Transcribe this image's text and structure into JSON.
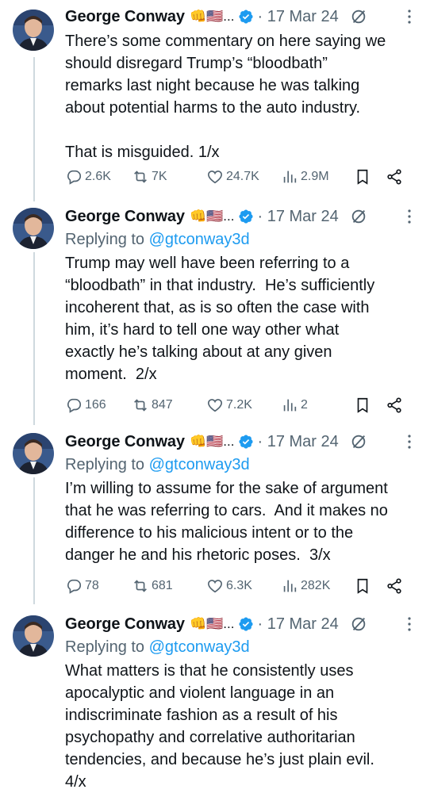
{
  "tweets": [
    {
      "author": "George Conway",
      "badges": "👊🇺🇸...",
      "time": "· 17 Mar 24",
      "replying_prefix": "",
      "replying_handle": "",
      "text": "There’s some commentary on here saying we\nshould disregard Trump’s “bloodbath”\nremarks last night because he was talking\nabout potential harms to the auto industry.\n\nThat is misguided. 1/x",
      "replies": "2.6K",
      "reposts": "7K",
      "likes": "24.7K",
      "views": "2.9M"
    },
    {
      "author": "George Conway",
      "badges": "👊🇺🇸...",
      "time": "· 17 Mar 24",
      "replying_prefix": "Replying to ",
      "replying_handle": "@gtconway3d",
      "text": "Trump may well have been referring to a\n“bloodbath” in that industry.  He’s sufficiently\nincoherent that, as is so often the case with\nhim, it’s hard to tell one way other what\nexactly he’s talking about at any given\nmoment.  2/x",
      "replies": "166",
      "reposts": "847",
      "likes": "7.2K",
      "views": "2"
    },
    {
      "author": "George Conway",
      "badges": "👊🇺🇸...",
      "time": "· 17 Mar 24",
      "replying_prefix": "Replying to ",
      "replying_handle": "@gtconway3d",
      "text": "I’m willing to assume for the sake of argument\nthat he was referring to cars.  And it makes no\ndifference to his malicious intent or to the\ndanger he and his rhetoric poses.  3/x",
      "replies": "78",
      "reposts": "681",
      "likes": "6.3K",
      "views": "282K"
    },
    {
      "author": "George Conway",
      "badges": "👊🇺🇸...",
      "time": "· 17 Mar 24",
      "replying_prefix": "Replying to ",
      "replying_handle": "@gtconway3d",
      "text": "What matters is that he consistently uses\napocalyptic and violent language in an\nindiscriminate fashion as a result of his\npsychopathy and correlative authoritarian\ntendencies, and because he’s just plain evil.\n4/x",
      "replies": "",
      "reposts": "",
      "likes": "",
      "views": ""
    }
  ],
  "colors": {
    "accent": "#1d9bf0",
    "muted": "#536471",
    "thread_line": "#cfd9de"
  },
  "icons": [
    "verified-icon",
    "grok-icon",
    "more-icon",
    "reply-icon",
    "repost-icon",
    "like-icon",
    "views-icon",
    "bookmark-icon",
    "share-icon"
  ]
}
